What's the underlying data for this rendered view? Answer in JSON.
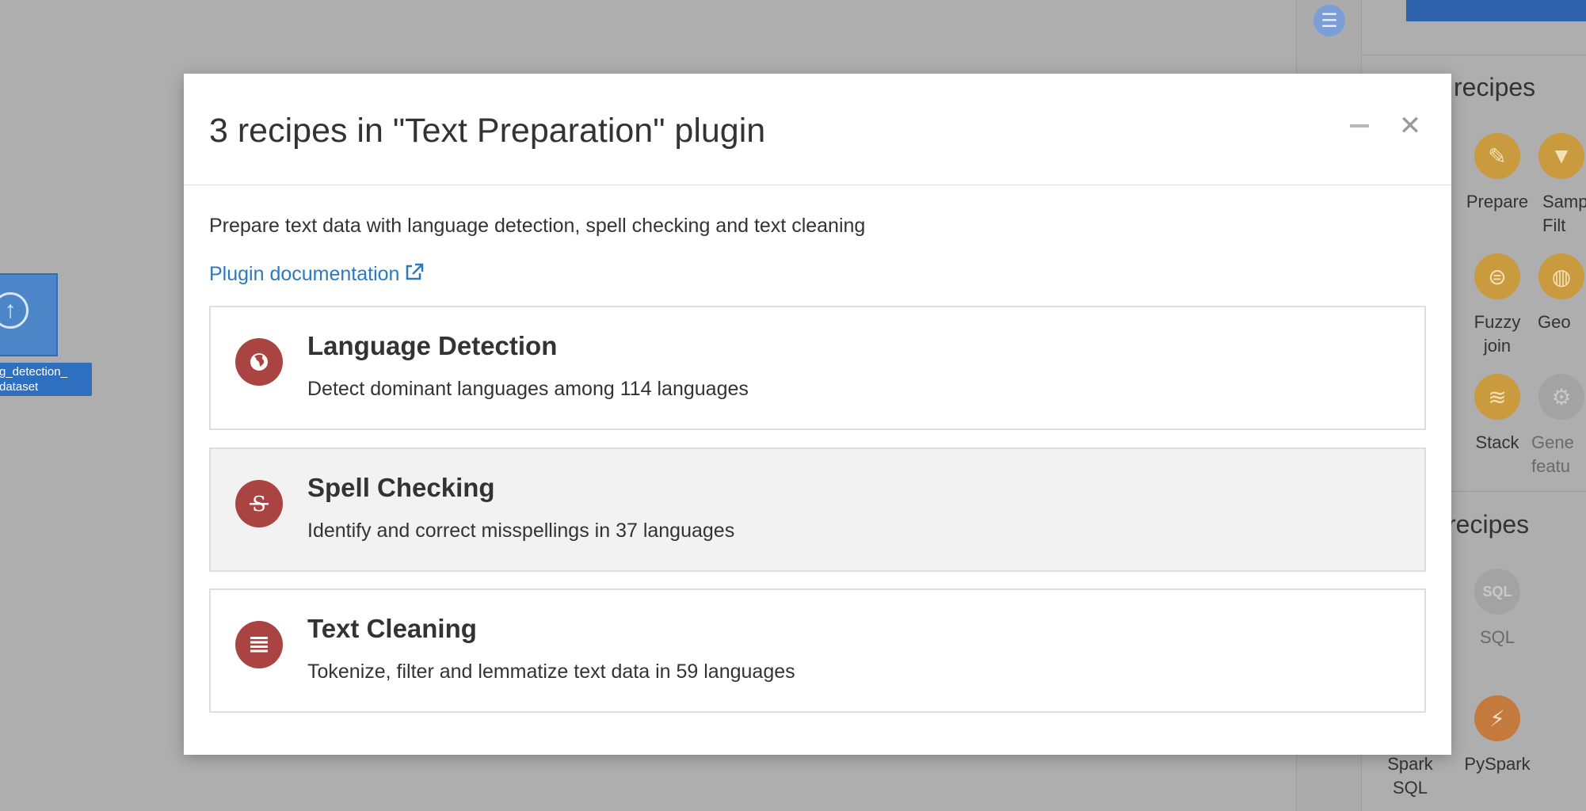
{
  "background": {
    "dataset_label_lines": [
      "g_detection_",
      "dataset"
    ],
    "side_panel": {
      "visual_heading": "recipes",
      "code_heading": "recipes",
      "visual_recipes": [
        {
          "label": "Prepare",
          "icon": "broom-icon"
        },
        {
          "label": "Samp Filt",
          "icon": "filter-icon"
        },
        {
          "label": "Fuzzy join",
          "icon": "fuzzy-join-icon"
        },
        {
          "label": "Geo",
          "icon": "globe-icon"
        },
        {
          "label": "Stack",
          "icon": "stack-icon"
        },
        {
          "label": "Gene featu",
          "icon": "gear-icon"
        }
      ],
      "code_recipes": [
        {
          "label": "SQL",
          "icon": "sql-icon"
        },
        {
          "label": "Spark SQL",
          "icon": "spark-sql-icon"
        },
        {
          "label": "PySpark",
          "icon": "pyspark-icon"
        }
      ]
    }
  },
  "modal": {
    "title": "3 recipes in \"Text Preparation\" plugin",
    "description": "Prepare text data with language detection, spell checking and text cleaning",
    "doc_link_label": "Plugin documentation",
    "recipes": [
      {
        "name": "Language Detection",
        "description": "Detect dominant languages among 114 languages",
        "icon": "globe-icon"
      },
      {
        "name": "Spell Checking",
        "description": "Identify and correct misspellings in 37 languages",
        "icon": "strikethrough-icon"
      },
      {
        "name": "Text Cleaning",
        "description": "Tokenize, filter and lemmatize text data in 59 languages",
        "icon": "list-lines-icon"
      }
    ]
  },
  "colors": {
    "overlay_bg": "#aeaeae",
    "recipe_icon": "#a94442",
    "link": "#2a7ac0",
    "dataset_blue": "#2e6fc0",
    "visual_recipe_gold": "#c99a3e"
  }
}
